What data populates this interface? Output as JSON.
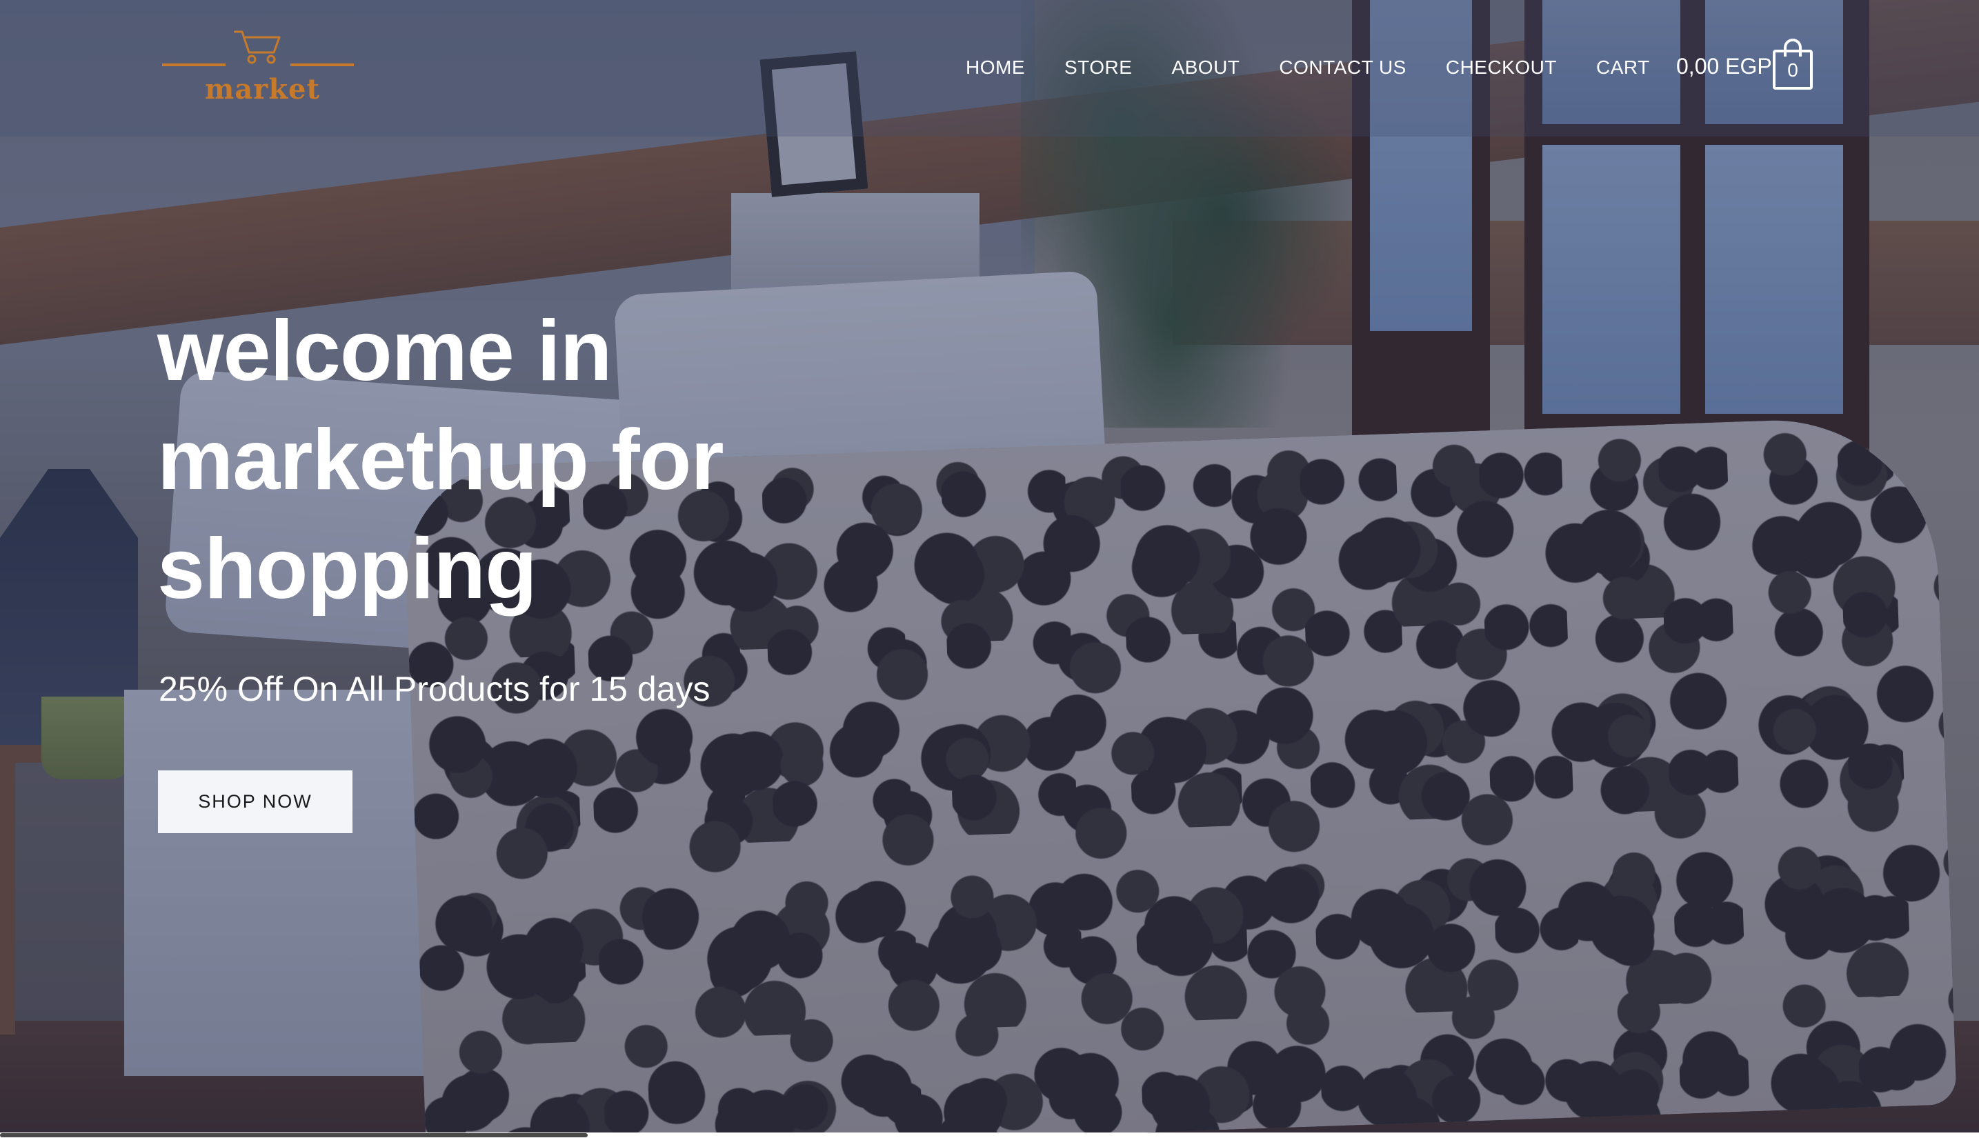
{
  "brand": {
    "logo_text": "market",
    "logo_color": "#c77a2a"
  },
  "nav": {
    "items": [
      {
        "label": "HOME"
      },
      {
        "label": "STORE"
      },
      {
        "label": "ABOUT"
      },
      {
        "label": "CONTACT US"
      },
      {
        "label": "CHECKOUT"
      },
      {
        "label": "CART"
      }
    ]
  },
  "cart": {
    "total": "0,00 EGP",
    "count": "0",
    "icon": "shopping-bag-icon"
  },
  "hero": {
    "headline": "welcome in markethup for shopping",
    "subline": "25% Off On All Products for 15 days",
    "cta_label": "SHOP NOW",
    "cta_background": "#f4f5f8"
  }
}
